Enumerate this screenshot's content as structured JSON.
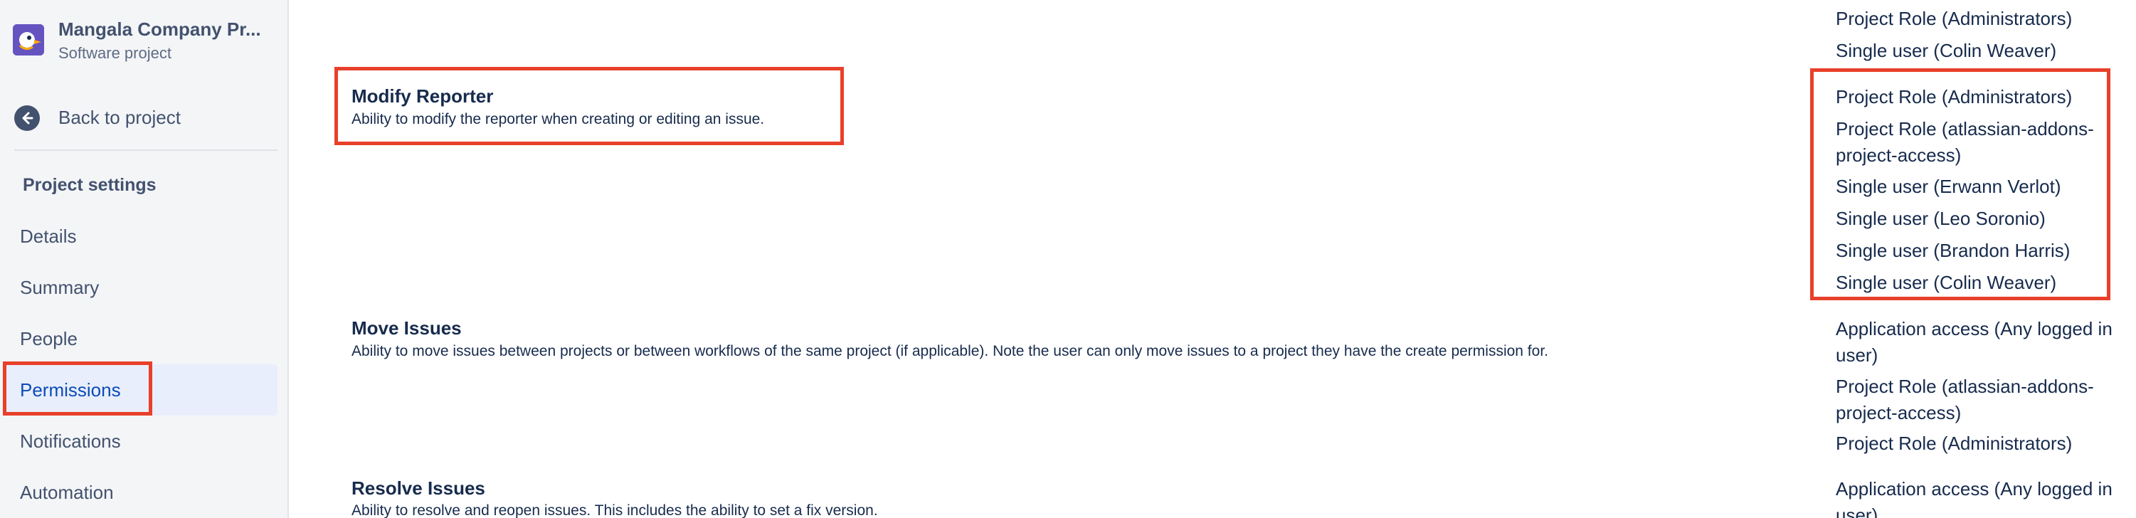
{
  "sidebar": {
    "project_name": "Mangala Company Pr...",
    "project_type": "Software project",
    "back_label": "Back to project",
    "section_title": "Project settings",
    "items": [
      {
        "label": "Details",
        "active": false
      },
      {
        "label": "Summary",
        "active": false
      },
      {
        "label": "People",
        "active": false
      },
      {
        "label": "Permissions",
        "active": true
      },
      {
        "label": "Notifications",
        "active": false
      },
      {
        "label": "Automation",
        "active": false
      }
    ]
  },
  "permissions": [
    {
      "title": "",
      "description": "",
      "grants": [
        "Project Role (Administrators)",
        "Single user (Colin Weaver)"
      ]
    },
    {
      "title": "Modify Reporter",
      "description": "Ability to modify the reporter when creating or editing an issue.",
      "grants": [
        "Project Role (Administrators)",
        "Project Role (atlassian-addons-project-access)",
        "Single user (Erwann Verlot)",
        "Single user (Leo Soronio)",
        "Single user (Brandon Harris)",
        "Single user (Colin Weaver)"
      ]
    },
    {
      "title": "Move Issues",
      "description": "Ability to move issues between projects or between workflows of the same project (if applicable). Note the user can only move issues to a project they have the create permission for.",
      "grants": [
        "Application access (Any logged in user)",
        "Project Role (atlassian-addons-project-access)",
        "Project Role (Administrators)"
      ]
    },
    {
      "title": "Resolve Issues",
      "description": "Ability to resolve and reopen issues. This includes the ability to set a fix version.",
      "grants": [
        "Application access (Any logged in user)"
      ]
    }
  ],
  "colors": {
    "annotation": "#e8402a",
    "active_nav_bg": "#e8eefb",
    "active_nav_text": "#0c4cb8",
    "avatar": "#6554c0"
  },
  "icons": {
    "project_avatar": "bird-logo-icon",
    "back": "arrow-left-circle-icon"
  }
}
